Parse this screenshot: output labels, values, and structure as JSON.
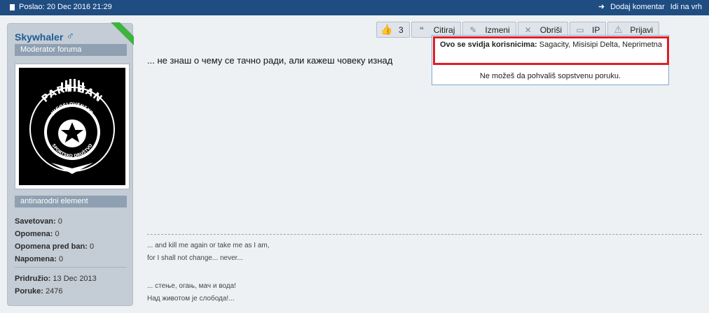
{
  "topbar": {
    "posted": "Poslao: 20 Dec 2016 21:29",
    "add_comment": "Dodaj komentar",
    "go_top": "Idi na vrh"
  },
  "user": {
    "name": "Skywhaler",
    "rank": "Moderator foruma",
    "title": "antinarodni element",
    "stats": {
      "warned_label": "Savetovan:",
      "warned": "0",
      "warnings_label": "Opomena:",
      "warnings": "0",
      "preban_label": "Opomena pred ban:",
      "preban": "0",
      "notes_label": "Napomena:",
      "notes": "0",
      "joined_label": "Pridružio:",
      "joined": "13 Dec 2013",
      "posts_label": "Poruke:",
      "posts": "2476"
    }
  },
  "avatar": {
    "lines": [
      "ПАРТИЗАН",
      "PARTIZAN",
      "JUGOSLOVENSKO",
      "SPORTSKO DRUŠTVO"
    ]
  },
  "actions": {
    "likes_count": "3",
    "quote": "Citiraj",
    "edit": "Izmeni",
    "delete": "Obriši",
    "ip": "IP",
    "report": "Prijavi"
  },
  "post": {
    "text": "... не знаш о чему се тачно ради, али кажеш човеку изнад"
  },
  "like_popup": {
    "label": "Ovo se svidja korisnicima:",
    "users": "Sagacity, Misisipi Delta, Neprimetna",
    "note": "Ne možeš da pohvališ sopstvenu poruku."
  },
  "signature": {
    "line1": "... and kill me again or take me as I am,",
    "line2": "for I shall not change... never...",
    "line3": "... стење, огањ, мач и вода!",
    "line4": "Над животом је слобода!..."
  },
  "colors": {
    "topbar": "#1f4d82",
    "username": "#1f5c96",
    "highlight_border": "#e01e24",
    "online_ribbon": "#3fb33f"
  },
  "icons": {
    "like": "thumbs-up-icon",
    "quote": "quote-icon",
    "edit": "pencil-icon",
    "delete": "delete-x-icon",
    "ip": "ip-icon",
    "report": "warning-icon",
    "gender": "male-icon"
  }
}
